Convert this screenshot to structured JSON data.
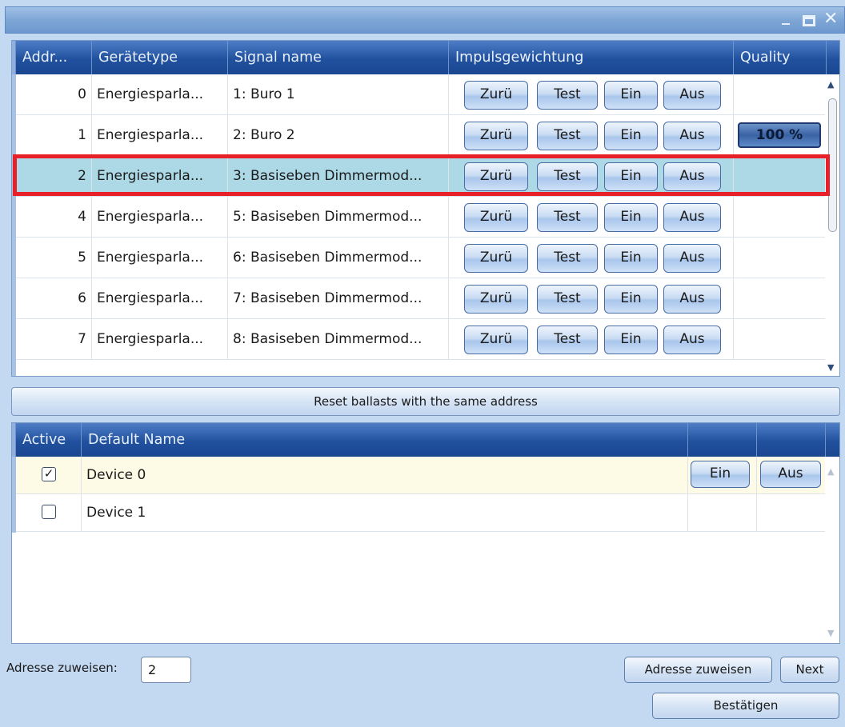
{
  "window": {
    "minimize_glyph": "_",
    "close_glyph": "✕"
  },
  "grid1": {
    "columns": [
      "Addr...",
      "Gerätetype",
      "Signal name",
      "Impulsgewichtung",
      "Quality"
    ],
    "button_labels": [
      "Zurü",
      "Test",
      "Ein",
      "Aus"
    ],
    "rows": [
      {
        "addr": "0",
        "type": "Energiesparla...",
        "signal": "1: Buro 1",
        "quality": ""
      },
      {
        "addr": "1",
        "type": "Energiesparla...",
        "signal": "2: Buro 2",
        "quality": "100 %"
      },
      {
        "addr": "2",
        "type": "Energiesparla...",
        "signal": "3: Basiseben Dimmermod...",
        "quality": "",
        "selected": true
      },
      {
        "addr": "4",
        "type": "Energiesparla...",
        "signal": "5: Basiseben Dimmermod...",
        "quality": ""
      },
      {
        "addr": "5",
        "type": "Energiesparla...",
        "signal": "6: Basiseben Dimmermod...",
        "quality": ""
      },
      {
        "addr": "6",
        "type": "Energiesparla...",
        "signal": "7: Basiseben Dimmermod...",
        "quality": ""
      },
      {
        "addr": "7",
        "type": "Energiesparla...",
        "signal": "8: Basiseben Dimmermod...",
        "quality": ""
      }
    ]
  },
  "reset_label": "Reset ballasts with the same address",
  "grid2": {
    "columns": [
      "Active",
      "Default Name"
    ],
    "rows": [
      {
        "checked": true,
        "name": "Device 0",
        "ein": "Ein",
        "aus": "Aus"
      },
      {
        "checked": false,
        "name": "Device 1"
      }
    ]
  },
  "footer": {
    "address_label": "Adresse zuweisen:",
    "address_value": "2",
    "assign_button": "Adresse zuweisen",
    "next_button": "Next",
    "confirm_button": "Bestätigen"
  },
  "colors": {
    "header": "#21519e",
    "selected_row": "#add8e6",
    "highlight_outline": "#e8202a"
  }
}
